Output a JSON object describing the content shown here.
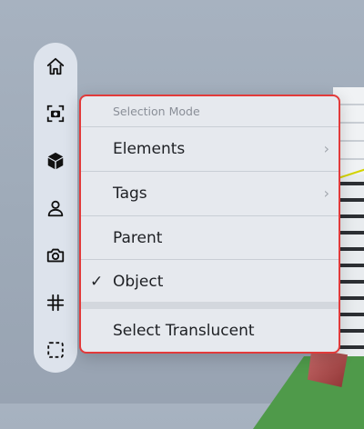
{
  "toolbar": {
    "tools": [
      {
        "name": "home-icon"
      },
      {
        "name": "screenshot-camera-icon"
      },
      {
        "name": "cube-icon"
      },
      {
        "name": "person-icon"
      },
      {
        "name": "camera-icon"
      },
      {
        "name": "grid-hash-icon"
      },
      {
        "name": "selection-box-icon"
      }
    ]
  },
  "menu": {
    "header": "Selection Mode",
    "items": [
      {
        "label": "Elements",
        "submenu": true
      },
      {
        "label": "Tags",
        "submenu": true
      },
      {
        "label": "Parent",
        "submenu": false
      },
      {
        "label": "Object",
        "checked": true,
        "check_mark": "✓"
      },
      {
        "label": "Select Translucent"
      }
    ],
    "chevron": "›"
  },
  "colors": {
    "highlight_border": "#e23a3a",
    "toolbar_bg": "#dde3ec",
    "menu_bg": "#e6e9ee"
  }
}
